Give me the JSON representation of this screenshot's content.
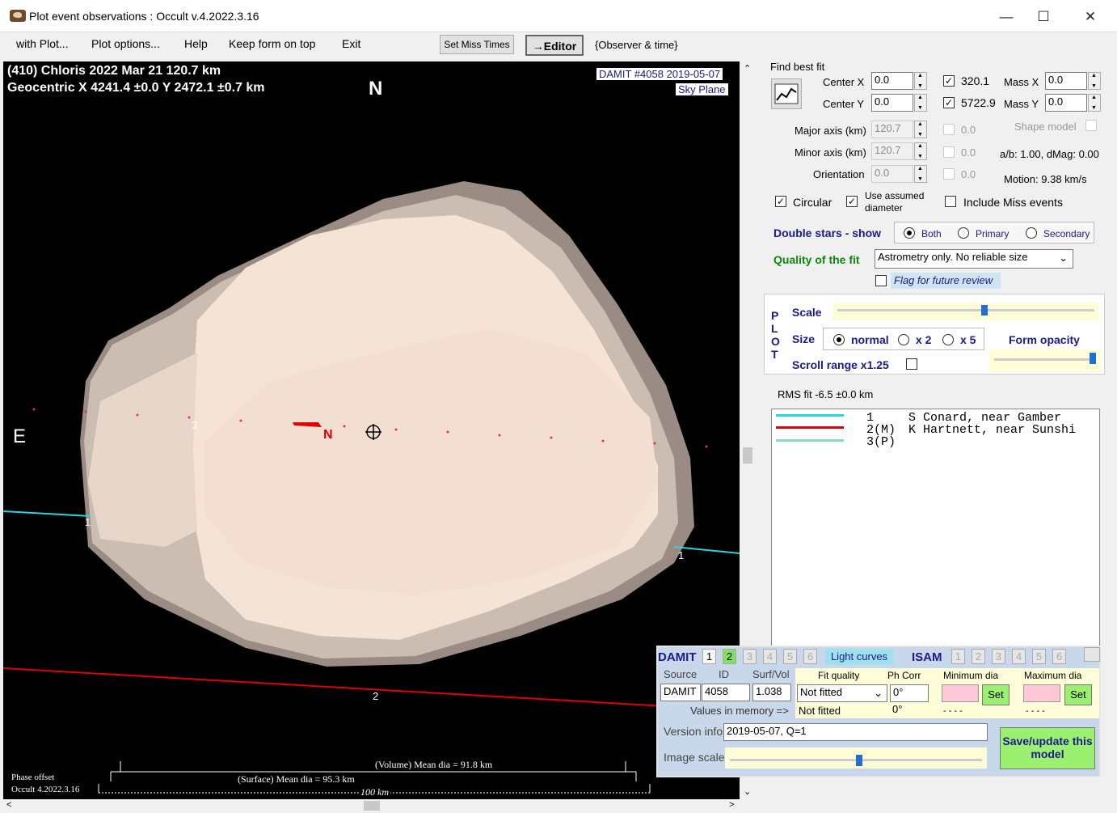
{
  "window": {
    "title": "Plot event observations : Occult v.4.2022.3.16"
  },
  "menu": {
    "with_plot": "with Plot...",
    "plot_options": "Plot options...",
    "help": "Help",
    "keep_on_top": "Keep form on top",
    "exit": "Exit",
    "set_miss": "Set Miss Times",
    "editor": "→Editor",
    "observer_time": "{Observer & time}"
  },
  "plot": {
    "line1": "(410) Chloris  2022 Mar 21   120.7 km",
    "line2": "Geocentric  X  4241.4 ±0.0  Y 2472.1 ±0.7 km",
    "north": "N",
    "east": "E",
    "damit": "DAMIT #4058 2019-05-07",
    "sky": "Sky Plane",
    "chord1": "1",
    "chord1b": "1",
    "chord2": "2",
    "chord3": "3",
    "nlabel": "N",
    "volume": "(Volume) Mean dia = 91.8 km",
    "surface": "(Surface) Mean dia = 95.3 km",
    "scale": "100 km",
    "phase": "Phase offset",
    "occult": "Occult 4.2022.3.16"
  },
  "fit": {
    "title": "Find best fit",
    "centerx_lbl": "Center X",
    "centerx": "0.0",
    "centery_lbl": "Center Y",
    "centery": "0.0",
    "v1": "320.1",
    "v2": "5722.9",
    "massx_lbl": "Mass X",
    "massx": "0.0",
    "massy_lbl": "Mass Y",
    "massy": "0.0",
    "major_lbl": "Major axis (km)",
    "major": "120.7",
    "minor_lbl": "Minor axis (km)",
    "minor": "120.7",
    "orient_lbl": "Orientation",
    "orient": "0.0",
    "z1": "0.0",
    "z2": "0.0",
    "z3": "0.0",
    "shape": "Shape model",
    "ab": "a/b: 1.00, dMag: 0.00",
    "motion": "Motion: 9.38 km/s",
    "circular": "Circular",
    "use_assumed": "Use assumed diameter",
    "include_miss": "Include Miss events",
    "double": "Double stars - show",
    "both": "Both",
    "primary": "Primary",
    "secondary": "Secondary",
    "quality_lbl": "Quality of the fit",
    "quality": "Astrometry only. No reliable size",
    "flag": "Flag for future review"
  },
  "plotpanel": {
    "p": "P",
    "l": "L",
    "o": "O",
    "t": "T",
    "scale": "Scale",
    "size": "Size",
    "normal": "normal",
    "x2": "x 2",
    "x5": "x 5",
    "opacity": "Form opacity",
    "scroll": "Scroll range x1.25"
  },
  "rms": {
    "label": "RMS fit -6.5 ±0.0 km",
    "rows": [
      {
        "n": "1",
        "o": "S Conard, near Gamber",
        "c": "#27d6e0"
      },
      {
        "n": "2(M)",
        "o": "K Hartnett, near Sunshi",
        "c": "#e00000"
      },
      {
        "n": "3(P)",
        "o": "",
        "c": "#8ad8c8"
      }
    ]
  },
  "damit": {
    "damit": "DAMIT",
    "n1": "1",
    "n2": "2",
    "n3": "3",
    "n4": "4",
    "n5": "5",
    "n6": "6",
    "light": "Light curves",
    "isam": "ISAM",
    "i1": "1",
    "i2": "2",
    "i3": "3",
    "i4": "4",
    "i5": "5",
    "i6": "6",
    "source_lbl": "Source",
    "id_lbl": "ID",
    "surf_lbl": "Surf/Vol",
    "source": "DAMIT",
    "id": "4058",
    "surf": "1.038",
    "fitq_lbl": "Fit quality",
    "phcorr_lbl": "Ph Corr",
    "mindia_lbl": "Minimum dia",
    "maxdia_lbl": "Maximum dia",
    "fitq": "Not fitted",
    "phcorr": "0°",
    "set": "Set",
    "set2": "Set",
    "values_lbl": "Values in memory =>",
    "mem_fit": "Not fitted",
    "mem_ph": "0°",
    "dash1": "- - - -",
    "dash2": "- - - -",
    "version_lbl": "Version info",
    "version": "2019-05-07, Q=1",
    "image_lbl": "Image scale",
    "save": "Save/update this model"
  }
}
